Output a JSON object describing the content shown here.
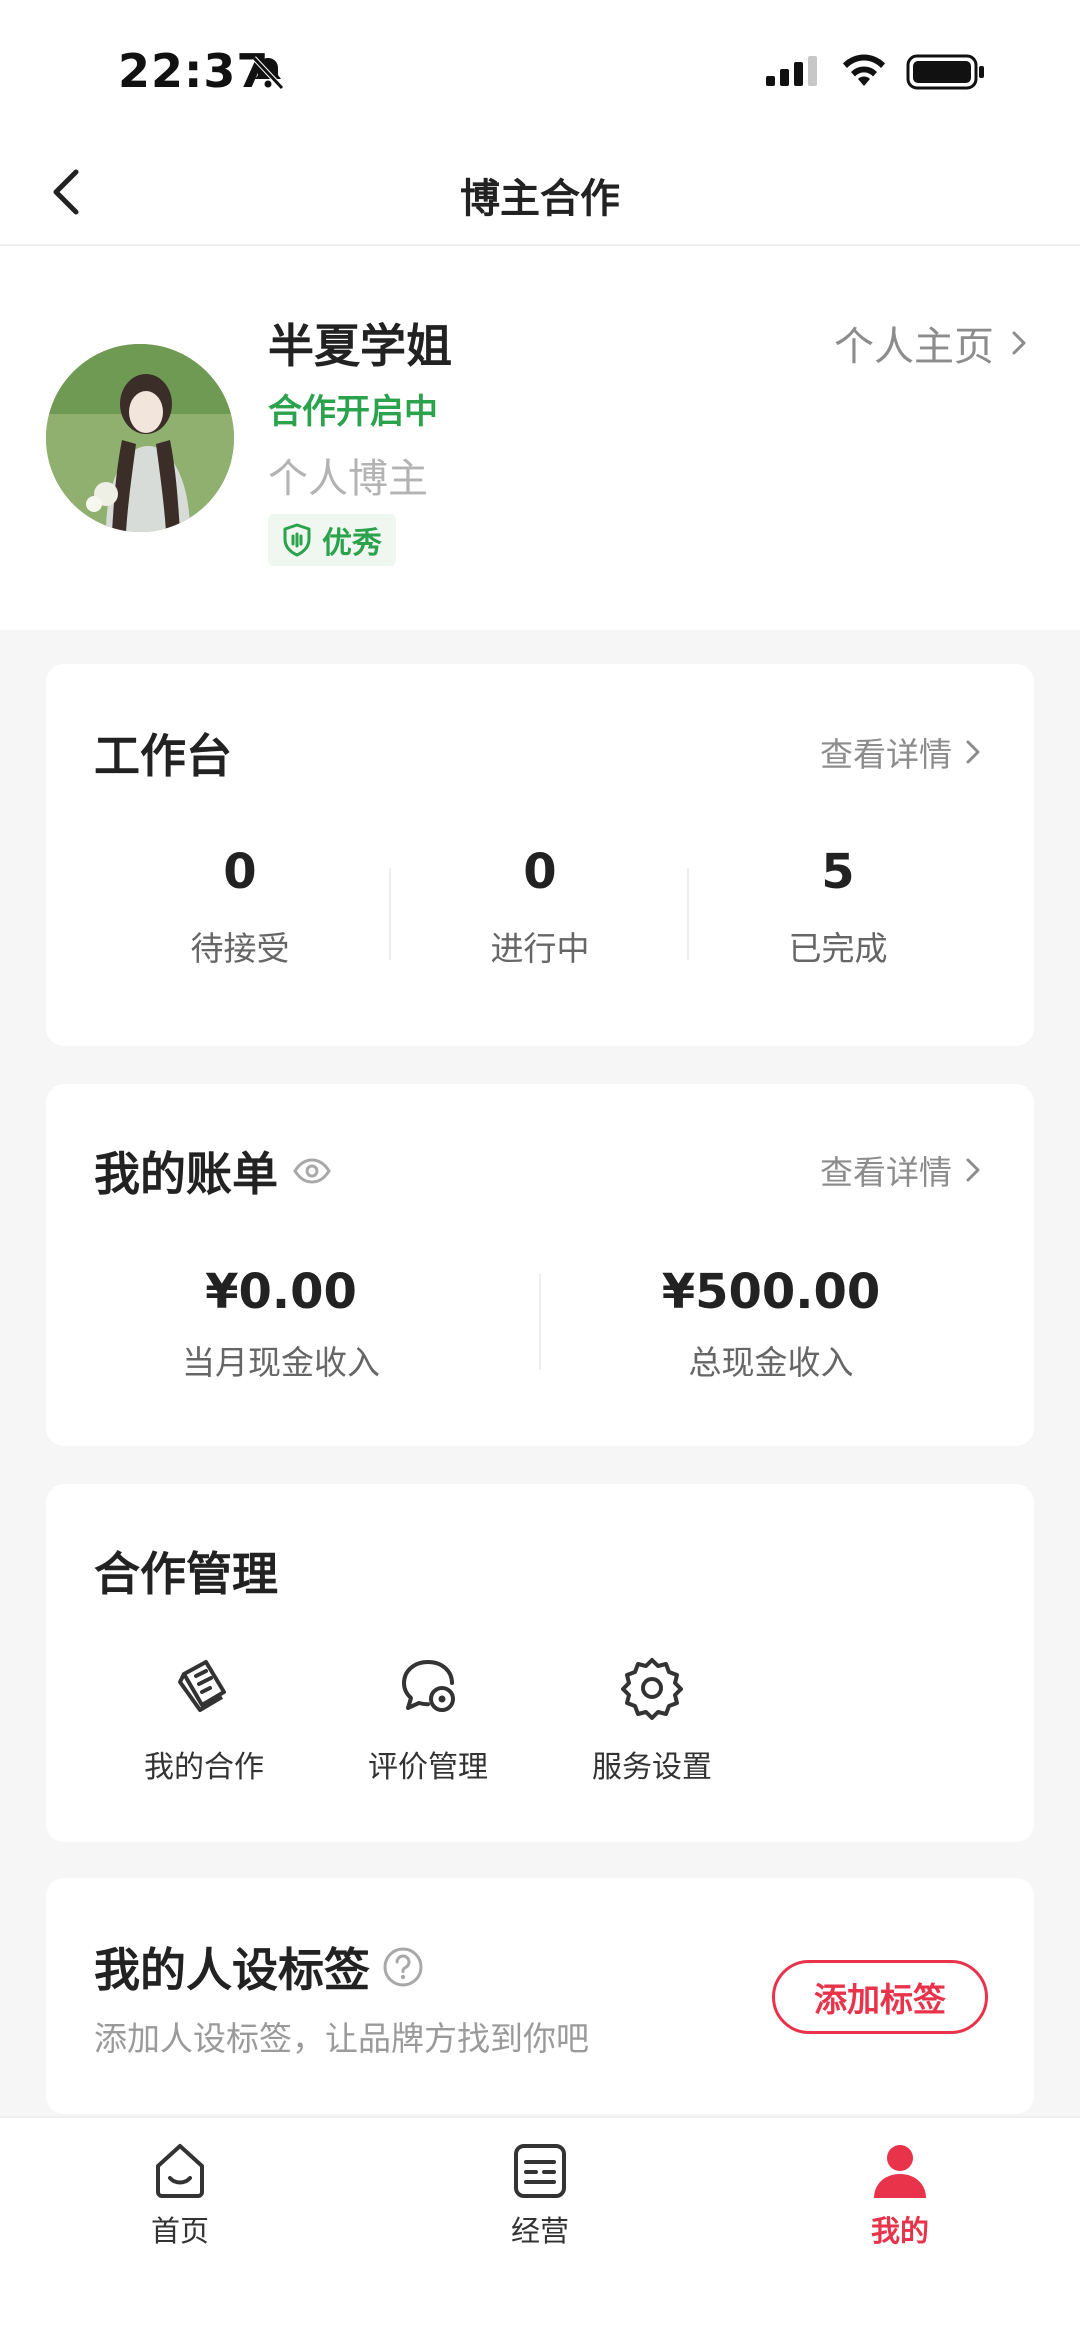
{
  "status_bar": {
    "time": "22:37"
  },
  "nav": {
    "title": "博主合作"
  },
  "profile": {
    "name": "半夏学姐",
    "status": "合作开启中",
    "type": "个人博主",
    "badge": "优秀",
    "homepage_link": "个人主页"
  },
  "workbench": {
    "title": "工作台",
    "details_link": "查看详情",
    "stats": [
      {
        "value": "0",
        "label": "待接受"
      },
      {
        "value": "0",
        "label": "进行中"
      },
      {
        "value": "5",
        "label": "已完成"
      }
    ]
  },
  "bill": {
    "title": "我的账单",
    "details_link": "查看详情",
    "items": [
      {
        "value": "¥0.00",
        "label": "当月现金收入"
      },
      {
        "value": "¥500.00",
        "label": "总现金收入"
      }
    ]
  },
  "cooperation": {
    "title": "合作管理",
    "items": [
      {
        "label": "我的合作",
        "icon": "document-icon"
      },
      {
        "label": "评价管理",
        "icon": "comment-icon"
      },
      {
        "label": "服务设置",
        "icon": "gear-icon"
      }
    ]
  },
  "tags": {
    "title": "我的人设标签",
    "subtitle": "添加人设标签，让品牌方找到你吧",
    "button": "添加标签"
  },
  "tab_bar": {
    "active_color": "#e8334a",
    "items": [
      {
        "label": "首页",
        "icon": "home-icon"
      },
      {
        "label": "经营",
        "icon": "list-icon"
      },
      {
        "label": "我的",
        "icon": "profile-icon"
      }
    ]
  }
}
